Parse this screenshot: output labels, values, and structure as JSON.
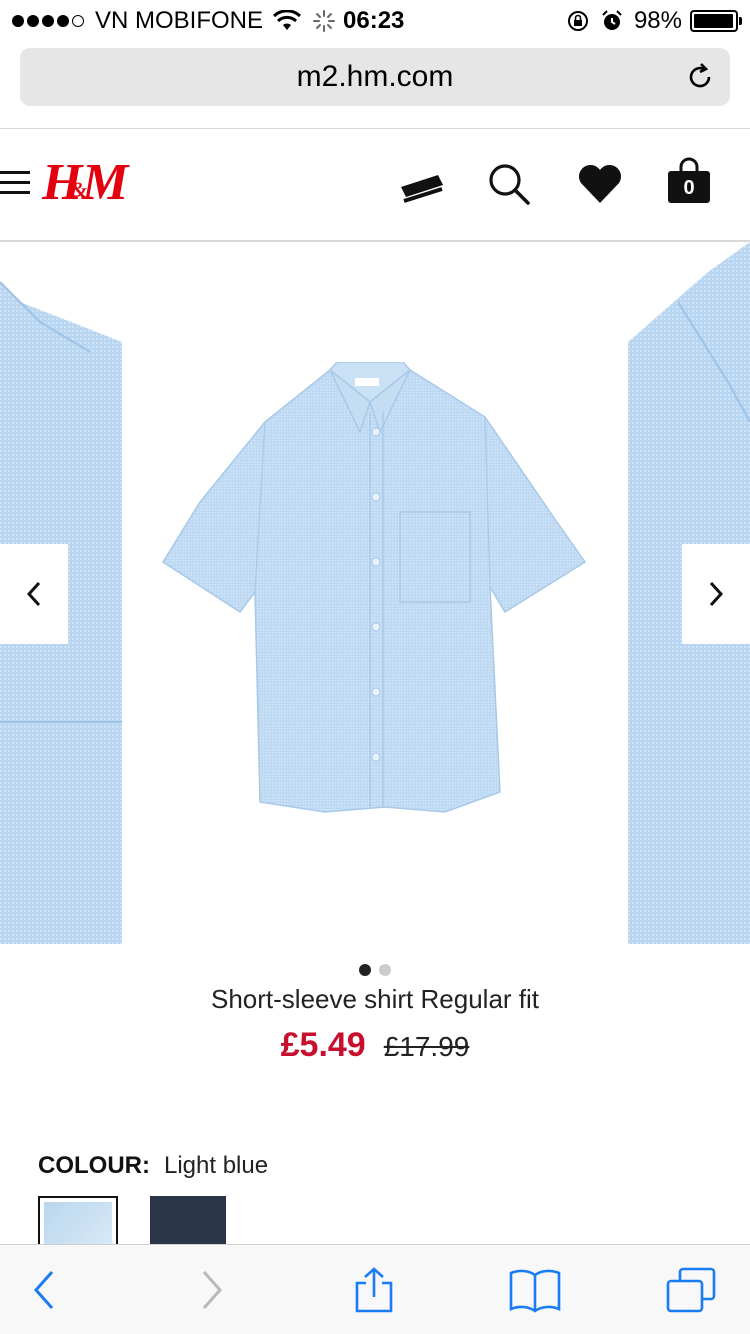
{
  "status_bar": {
    "carrier": "VN MOBIFONE",
    "time": "06:23",
    "battery": "98%",
    "battery_level": 0.98
  },
  "browser": {
    "url": "m2.hm.com"
  },
  "site_header": {
    "logo_text": "H&M",
    "bag_count": "0"
  },
  "product": {
    "name": "Short-sleeve shirt Regular fit",
    "price_sale": "£5.49",
    "price_original": "£17.99",
    "image_count": 2,
    "active_image": 1,
    "colour_label": "COLOUR:",
    "colour_value": "Light blue",
    "swatches": [
      {
        "name": "Light blue",
        "color": "#c4ddf1",
        "selected": true
      },
      {
        "name": "Dark blue",
        "color": "#2a3548",
        "selected": false
      }
    ]
  },
  "colors": {
    "sale_red": "#c8102e",
    "shirt_blue": "#bcd8f2",
    "toolbar_blue": "#1a7cf4"
  },
  "icons": {
    "menu": "hamburger-menu-icon",
    "card": "membership-card-icon",
    "search": "search-icon",
    "favourites": "heart-icon",
    "bag": "shopping-bag-icon",
    "reload": "reload-icon"
  }
}
